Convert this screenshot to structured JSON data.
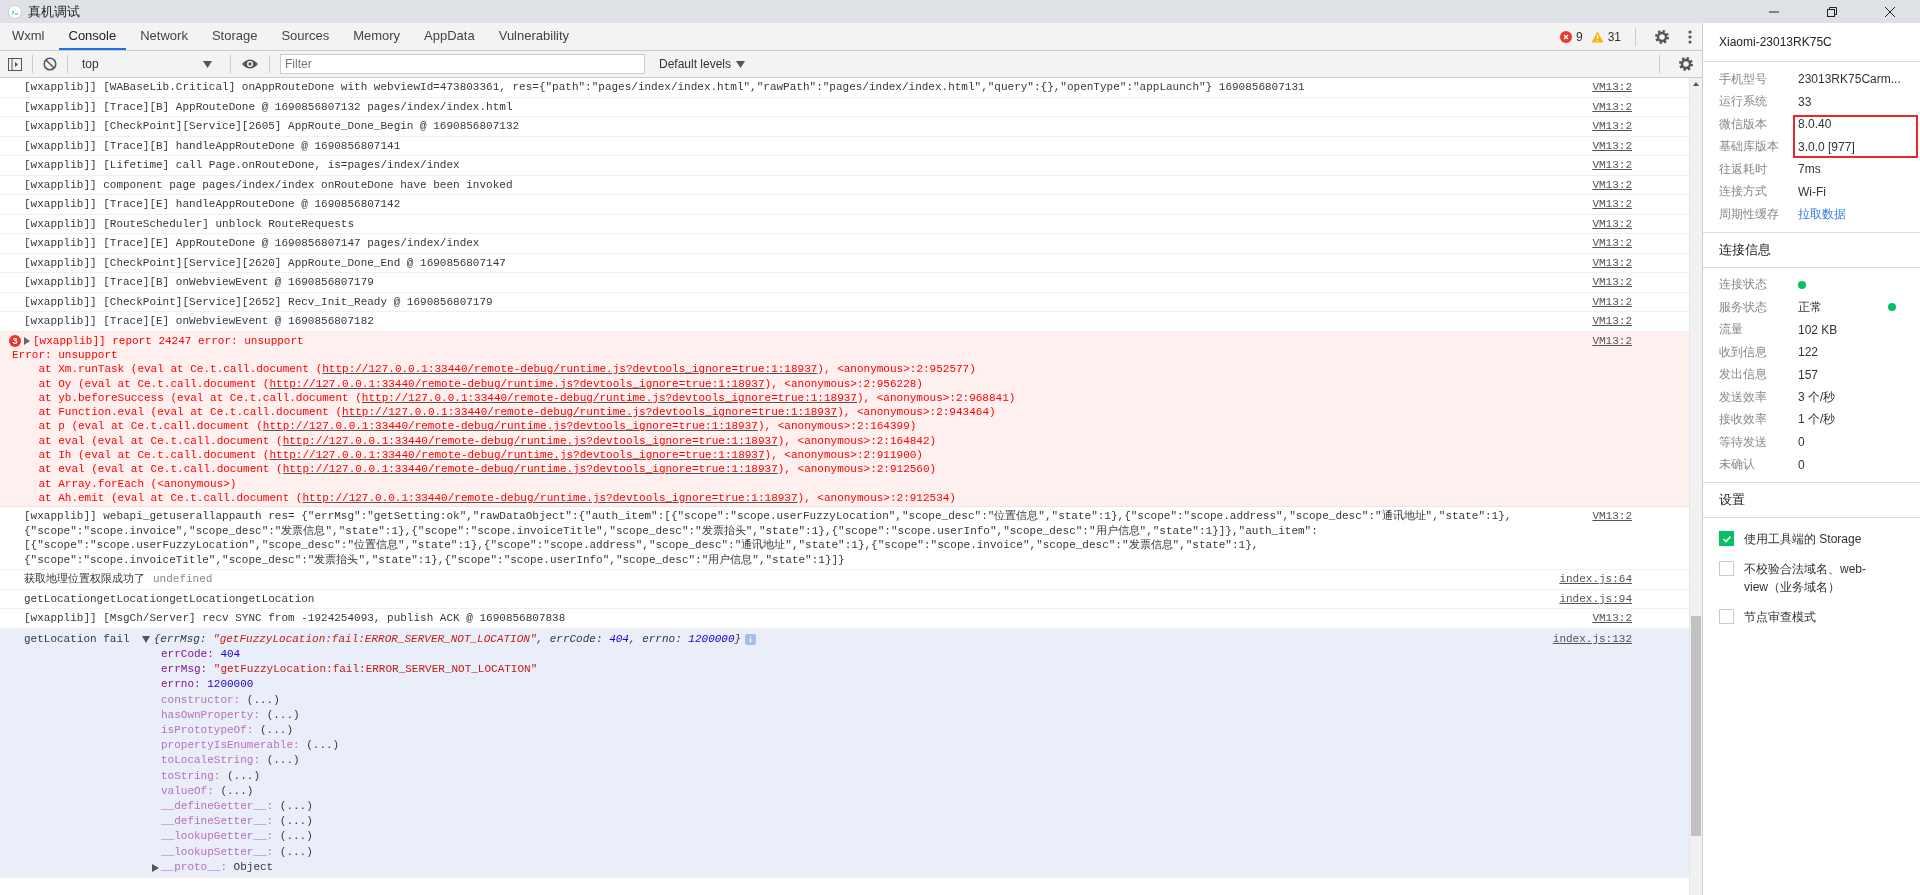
{
  "window": {
    "title": "真机调试"
  },
  "tabs": [
    {
      "label": "Wxml",
      "selected": false
    },
    {
      "label": "Console",
      "selected": true
    },
    {
      "label": "Network",
      "selected": false
    },
    {
      "label": "Storage",
      "selected": false
    },
    {
      "label": "Sources",
      "selected": false
    },
    {
      "label": "Memory",
      "selected": false
    },
    {
      "label": "AppData",
      "selected": false
    },
    {
      "label": "Vulnerability",
      "selected": false
    }
  ],
  "counts": {
    "errors": "9",
    "warnings": "31"
  },
  "toolbar": {
    "context": "top",
    "filter_placeholder": "Filter",
    "levels": "Default levels"
  },
  "console": [
    {
      "kind": "log",
      "text": "[wxapplib]] [WABaseLib.Critical] onAppRouteDone with webviewId=473803361, res={\"path\":\"pages/index/index.html\",\"rawPath\":\"pages/index/index.html\",\"query\":{},\"openType\":\"appLaunch\"} 1690856807131",
      "source": "VM13:2"
    },
    {
      "kind": "log",
      "text": "[wxapplib]] [Trace][B] AppRouteDone @ 1690856807132 pages/index/index.html",
      "source": "VM13:2"
    },
    {
      "kind": "log",
      "text": "[wxapplib]] [CheckPoint][Service][2605] AppRoute_Done_Begin @ 1690856807132",
      "source": "VM13:2"
    },
    {
      "kind": "log",
      "text": "[wxapplib]] [Trace][B] handleAppRouteDone @ 1690856807141",
      "source": "VM13:2"
    },
    {
      "kind": "log",
      "text": "[wxapplib]] [Lifetime] call Page.onRouteDone, is=pages/index/index",
      "source": "VM13:2"
    },
    {
      "kind": "log",
      "text": "[wxapplib]] component page pages/index/index onRouteDone have been invoked",
      "source": "VM13:2"
    },
    {
      "kind": "log",
      "text": "[wxapplib]] [Trace][E] handleAppRouteDone @ 1690856807142",
      "source": "VM13:2"
    },
    {
      "kind": "log",
      "text": "[wxapplib]] [RouteScheduler] unblock RouteRequests",
      "source": "VM13:2"
    },
    {
      "kind": "log",
      "text": "[wxapplib]] [Trace][E] AppRouteDone @ 1690856807147 pages/index/index",
      "source": "VM13:2"
    },
    {
      "kind": "log",
      "text": "[wxapplib]] [CheckPoint][Service][2620] AppRoute_Done_End @ 1690856807147",
      "source": "VM13:2"
    },
    {
      "kind": "log",
      "text": "[wxapplib]] [Trace][B] onWebviewEvent @ 1690856807179",
      "source": "VM13:2"
    },
    {
      "kind": "log",
      "text": "[wxapplib]] [CheckPoint][Service][2652] Recv_Init_Ready @ 1690856807179",
      "source": "VM13:2"
    },
    {
      "kind": "log",
      "text": "[wxapplib]] [Trace][E] onWebviewEvent @ 1690856807182",
      "source": "VM13:2"
    },
    {
      "kind": "error",
      "count": "3",
      "text": "[wxapplib]] report 24247 error: unsupport",
      "source": "VM13:2",
      "details": [
        {
          "prefix": "Error: unsupport"
        },
        {
          "prefix": "    at Xm.runTask (eval at Ce.t.call.document (",
          "url": "http://127.0.0.1:33440/remote-debug/runtime.js?devtools_ignore=true:1:18937",
          "suffix": "), <anonymous>:2:952577)"
        },
        {
          "prefix": "    at Oy (eval at Ce.t.call.document (",
          "url": "http://127.0.0.1:33440/remote-debug/runtime.js?devtools_ignore=true:1:18937",
          "suffix": "), <anonymous>:2:956228)"
        },
        {
          "prefix": "    at yb.beforeSuccess (eval at Ce.t.call.document (",
          "url": "http://127.0.0.1:33440/remote-debug/runtime.js?devtools_ignore=true:1:18937",
          "suffix": "), <anonymous>:2:968841)"
        },
        {
          "prefix": "    at Function.eval (eval at Ce.t.call.document (",
          "url": "http://127.0.0.1:33440/remote-debug/runtime.js?devtools_ignore=true:1:18937",
          "suffix": "), <anonymous>:2:943464)"
        },
        {
          "prefix": "    at p (eval at Ce.t.call.document (",
          "url": "http://127.0.0.1:33440/remote-debug/runtime.js?devtools_ignore=true:1:18937",
          "suffix": "), <anonymous>:2:164399)"
        },
        {
          "prefix": "    at eval (eval at Ce.t.call.document (",
          "url": "http://127.0.0.1:33440/remote-debug/runtime.js?devtools_ignore=true:1:18937",
          "suffix": "), <anonymous>:2:164842)"
        },
        {
          "prefix": "    at Ih (eval at Ce.t.call.document (",
          "url": "http://127.0.0.1:33440/remote-debug/runtime.js?devtools_ignore=true:1:18937",
          "suffix": "), <anonymous>:2:911900)"
        },
        {
          "prefix": "    at eval (eval at Ce.t.call.document (",
          "url": "http://127.0.0.1:33440/remote-debug/runtime.js?devtools_ignore=true:1:18937",
          "suffix": "), <anonymous>:2:912560)"
        },
        {
          "prefix": "    at Array.forEach (<anonymous>)"
        },
        {
          "prefix": "    at Ah.emit (eval at Ce.t.call.document (",
          "url": "http://127.0.0.1:33440/remote-debug/runtime.js?devtools_ignore=true:1:18937",
          "suffix": "), <anonymous>:2:912534)"
        }
      ]
    },
    {
      "kind": "log",
      "text": "[wxapplib]] webapi_getuserallappauth res= {\"errMsg\":\"getSetting:ok\",\"rawDataObject\":{\"auth_item\":[{\"scope\":\"scope.userFuzzyLocation\",\"scope_desc\":\"位置信息\",\"state\":1},{\"scope\":\"scope.address\",\"scope_desc\":\"通讯地址\",\"state\":1}, {\"scope\":\"scope.invoice\",\"scope_desc\":\"发票信息\",\"state\":1},{\"scope\":\"scope.invoiceTitle\",\"scope_desc\":\"发票抬头\",\"state\":1},{\"scope\":\"scope.userInfo\",\"scope_desc\":\"用户信息\",\"state\":1}]},\"auth_item\": [{\"scope\":\"scope.userFuzzyLocation\",\"scope_desc\":\"位置信息\",\"state\":1},{\"scope\":\"scope.address\",\"scope_desc\":\"通讯地址\",\"state\":1},{\"scope\":\"scope.invoice\",\"scope_desc\":\"发票信息\",\"state\":1},{\"scope\":\"scope.invoiceTitle\",\"scope_desc\":\"发票抬头\",\"state\":1},{\"scope\":\"scope.userInfo\",\"scope_desc\":\"用户信息\",\"state\":1}]}",
      "source": "VM13:2"
    },
    {
      "kind": "log",
      "text": "获取地理位置权限成功了",
      "extra": "undefined",
      "source": "index.js:64"
    },
    {
      "kind": "log",
      "text": "getLocationgetLocationgetLocationgetLocation",
      "source": "index.js:94"
    },
    {
      "kind": "log",
      "text": "[wxapplib]] [MsgCh/Server] recv SYNC from -1924254093, publish ACK @ 1690856807838",
      "source": "VM13:2"
    },
    {
      "kind": "object",
      "text": "getLocation fail",
      "expanded": true,
      "source": "index.js:132",
      "preview": [
        {
          "text": "{errMsg: ",
          "kind": "plain"
        },
        {
          "text": "\"getFuzzyLocation:fail:ERROR_SERVER_NOT_LOCATION\"",
          "kind": "string"
        },
        {
          "text": ", errCode: ",
          "kind": "plain"
        },
        {
          "text": "404",
          "kind": "number"
        },
        {
          "text": ", errno: ",
          "kind": "plain"
        },
        {
          "text": "1200000",
          "kind": "number"
        },
        {
          "text": "}",
          "kind": "plain"
        }
      ],
      "properties": [
        {
          "key": "errCode:",
          "value": "404",
          "kind": "number",
          "own": true
        },
        {
          "key": "errMsg:",
          "value": "\"getFuzzyLocation:fail:ERROR_SERVER_NOT_LOCATION\"",
          "kind": "string",
          "own": true
        },
        {
          "key": "errno:",
          "value": "1200000",
          "kind": "number",
          "own": true
        },
        {
          "key": "constructor:",
          "value": "(...)",
          "kind": "getter",
          "own": false
        },
        {
          "key": "hasOwnProperty:",
          "value": "(...)",
          "kind": "getter",
          "own": false
        },
        {
          "key": "isPrototypeOf:",
          "value": "(...)",
          "kind": "getter",
          "own": false
        },
        {
          "key": "propertyIsEnumerable:",
          "value": "(...)",
          "kind": "getter",
          "own": false
        },
        {
          "key": "toLocaleString:",
          "value": "(...)",
          "kind": "getter",
          "own": false
        },
        {
          "key": "toString:",
          "value": "(...)",
          "kind": "getter",
          "own": false
        },
        {
          "key": "valueOf:",
          "value": "(...)",
          "kind": "getter",
          "own": false
        },
        {
          "key": "__defineGetter__:",
          "value": "(...)",
          "kind": "getter",
          "own": false
        },
        {
          "key": "__defineSetter__:",
          "value": "(...)",
          "kind": "getter",
          "own": false
        },
        {
          "key": "__lookupGetter__:",
          "value": "(...)",
          "kind": "getter",
          "own": false
        },
        {
          "key": "__lookupSetter__:",
          "value": "(...)",
          "kind": "getter",
          "own": false
        },
        {
          "key": "__proto__:",
          "value": "Object",
          "kind": "object",
          "own": false,
          "expanded": false
        }
      ]
    }
  ],
  "device": {
    "name": "Xiaomi-23013RK75C",
    "groups": [
      {
        "highlighted": false,
        "rows": [
          {
            "label": "手机型号",
            "value": "23013RK75Carm..."
          },
          {
            "label": "运行系统",
            "value": "33"
          }
        ]
      },
      {
        "highlighted": true,
        "rows": [
          {
            "label": "微信版本",
            "value": "8.0.40"
          },
          {
            "label": "基础库版本",
            "value": "3.0.0 [977]"
          }
        ]
      },
      {
        "highlighted": false,
        "rows": [
          {
            "label": "往返耗时",
            "value": "7ms"
          },
          {
            "label": "连接方式",
            "value": "Wi-Fi"
          },
          {
            "label": "周期性缓存",
            "value": "拉取数据",
            "kind": "link"
          }
        ]
      }
    ]
  },
  "connection": {
    "title": "连接信息",
    "rows": [
      {
        "label": "连接状态",
        "kind": "dot",
        "color": "#07c160"
      },
      {
        "label": "服务状态",
        "value": "正常",
        "kind": "text_dot",
        "color": "#07c160"
      },
      {
        "label": "流量",
        "value": "102 KB"
      },
      {
        "label": "收到信息",
        "value": "122"
      },
      {
        "label": "发出信息",
        "value": "157"
      },
      {
        "label": "发送效率",
        "value": "3 个/秒"
      },
      {
        "label": "接收效率",
        "value": "1 个/秒"
      },
      {
        "label": "等待发送",
        "value": "0"
      },
      {
        "label": "未确认",
        "value": "0"
      }
    ]
  },
  "settings": {
    "title": "设置",
    "options": [
      {
        "label": "使用工具端的 Storage",
        "checked": true
      },
      {
        "label": "不校验合法域名、web-view（业务域名）",
        "checked": false
      },
      {
        "label": "节点审查模式",
        "checked": false
      }
    ]
  }
}
